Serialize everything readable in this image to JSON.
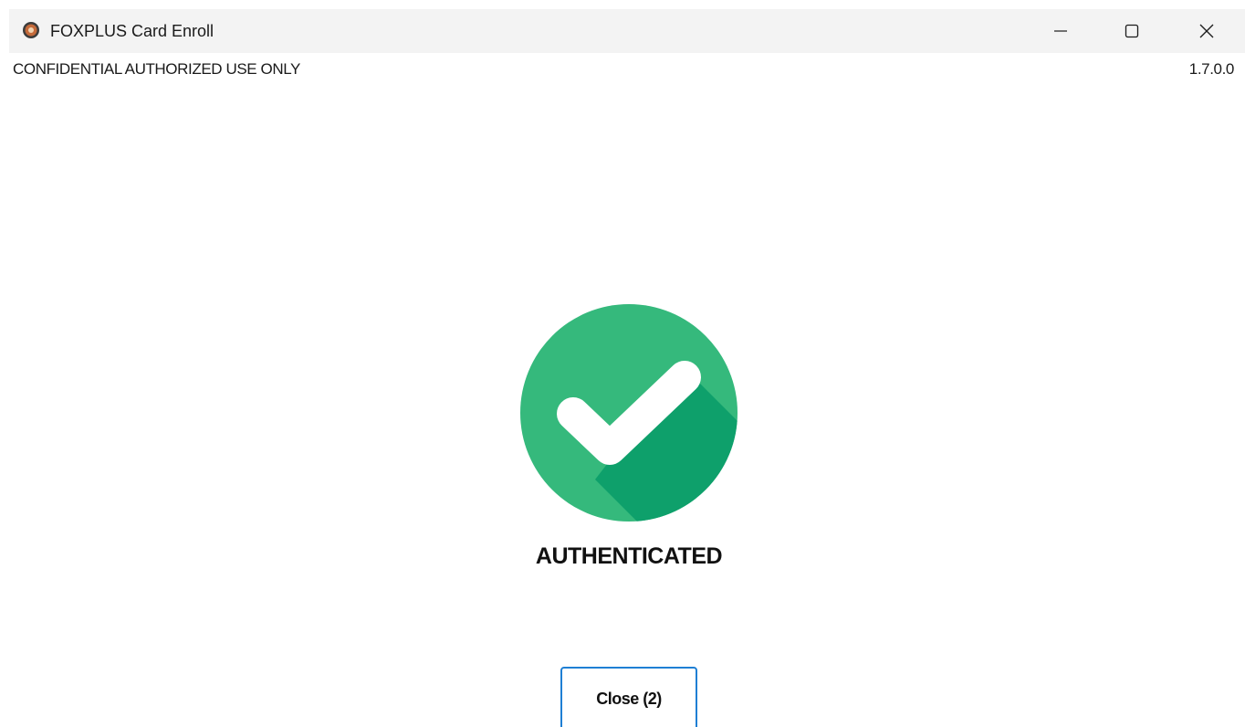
{
  "window": {
    "title": "FOXPLUS Card Enroll",
    "app_icon": "foxplus-app-icon",
    "controls": {
      "minimize_icon": "minimize-icon",
      "maximize_icon": "maximize-icon",
      "close_icon": "close-icon"
    }
  },
  "header": {
    "confidential_text": "CONFIDENTIAL AUTHORIZED USE ONLY",
    "version": "1.7.0.0"
  },
  "status": {
    "icon": "check-circle-icon",
    "text": "AUTHENTICATED",
    "colors": {
      "circle": "#35b97c",
      "shadow": "#0ea06b",
      "check": "#ffffff"
    }
  },
  "actions": {
    "close_label": "Close (2)",
    "accent": "#1f7fd4"
  }
}
